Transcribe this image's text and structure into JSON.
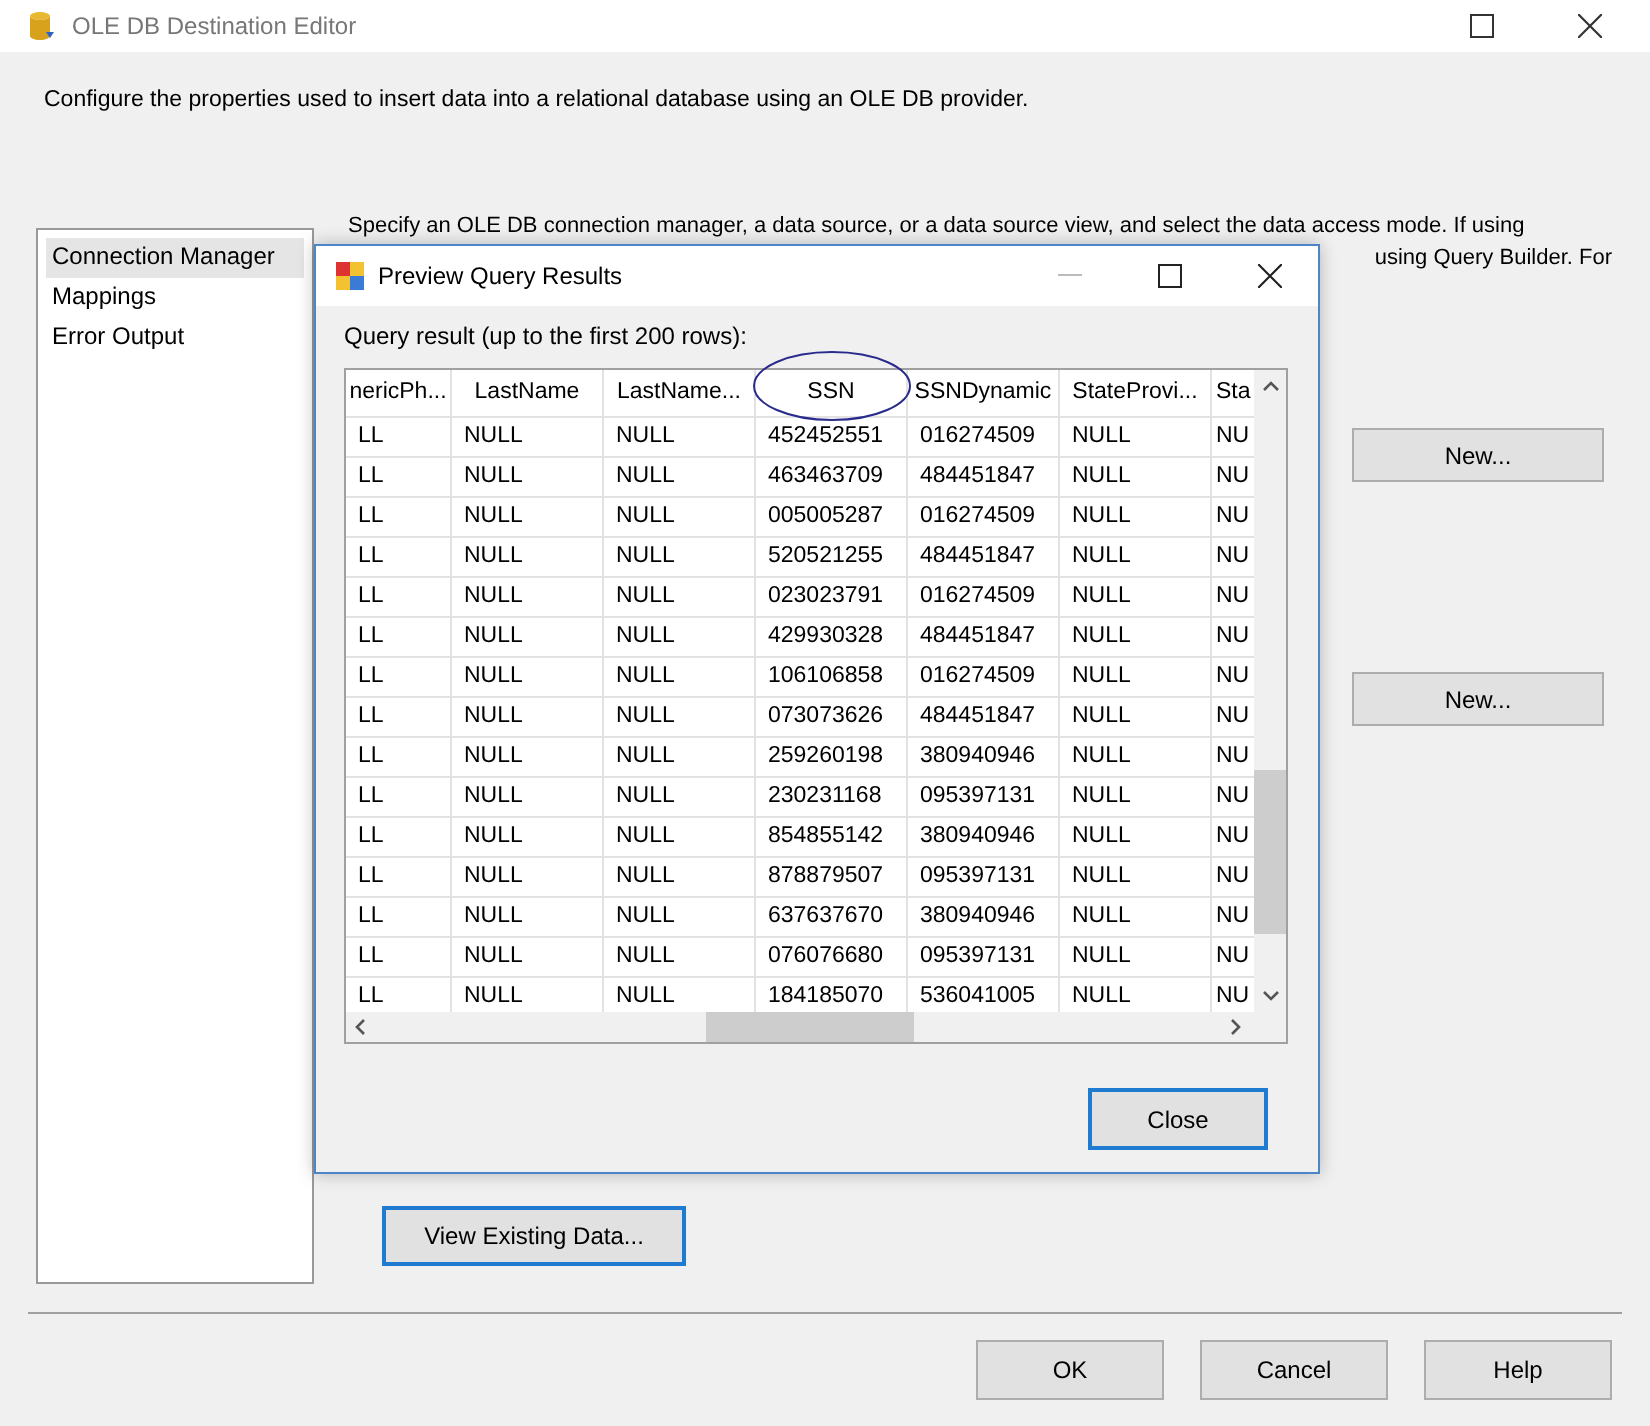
{
  "window": {
    "title": "OLE DB Destination Editor"
  },
  "description": "Configure the properties used to insert data into a relational database using an OLE DB provider.",
  "nav": [
    {
      "label": "Connection Manager",
      "selected": true
    },
    {
      "label": "Mappings",
      "selected": false
    },
    {
      "label": "Error Output",
      "selected": false
    }
  ],
  "intro_text": {
    "line_1": "Specify an OLE DB connection manager, a data source, or a data source view, and select the data access mode. If using",
    "line_2": "using Query Builder. For"
  },
  "new_buttons": [
    "New...",
    "New..."
  ],
  "view_existing_button": "View Existing Data...",
  "footer_buttons": [
    "OK",
    "Cancel",
    "Help"
  ],
  "dialog": {
    "title": "Preview Query Results",
    "caption": "Query result (up to the first 200 rows):",
    "columns": [
      {
        "label": "nericPh...",
        "circled": false
      },
      {
        "label": "LastName",
        "circled": false
      },
      {
        "label": "LastName...",
        "circled": false
      },
      {
        "label": "SSN",
        "circled": true
      },
      {
        "label": "SSNDynamic",
        "circled": false
      },
      {
        "label": "StateProvi...",
        "circled": false
      },
      {
        "label": "Sta",
        "circled": false
      }
    ],
    "rows": [
      [
        "LL",
        "NULL",
        "NULL",
        "452452551",
        "016274509",
        "NULL",
        "NU"
      ],
      [
        "LL",
        "NULL",
        "NULL",
        "463463709",
        "484451847",
        "NULL",
        "NU"
      ],
      [
        "LL",
        "NULL",
        "NULL",
        "005005287",
        "016274509",
        "NULL",
        "NU"
      ],
      [
        "LL",
        "NULL",
        "NULL",
        "520521255",
        "484451847",
        "NULL",
        "NU"
      ],
      [
        "LL",
        "NULL",
        "NULL",
        "023023791",
        "016274509",
        "NULL",
        "NU"
      ],
      [
        "LL",
        "NULL",
        "NULL",
        "429930328",
        "484451847",
        "NULL",
        "NU"
      ],
      [
        "LL",
        "NULL",
        "NULL",
        "106106858",
        "016274509",
        "NULL",
        "NU"
      ],
      [
        "LL",
        "NULL",
        "NULL",
        "073073626",
        "484451847",
        "NULL",
        "NU"
      ],
      [
        "LL",
        "NULL",
        "NULL",
        "259260198",
        "380940946",
        "NULL",
        "NU"
      ],
      [
        "LL",
        "NULL",
        "NULL",
        "230231168",
        "095397131",
        "NULL",
        "NU"
      ],
      [
        "LL",
        "NULL",
        "NULL",
        "854855142",
        "380940946",
        "NULL",
        "NU"
      ],
      [
        "LL",
        "NULL",
        "NULL",
        "878879507",
        "095397131",
        "NULL",
        "NU"
      ],
      [
        "LL",
        "NULL",
        "NULL",
        "637637670",
        "380940946",
        "NULL",
        "NU"
      ],
      [
        "LL",
        "NULL",
        "NULL",
        "076076680",
        "095397131",
        "NULL",
        "NU"
      ],
      [
        "LL",
        "NULL",
        "NULL",
        "184185070",
        "536041005",
        "NULL",
        "NU"
      ]
    ],
    "close_button": "Close"
  }
}
